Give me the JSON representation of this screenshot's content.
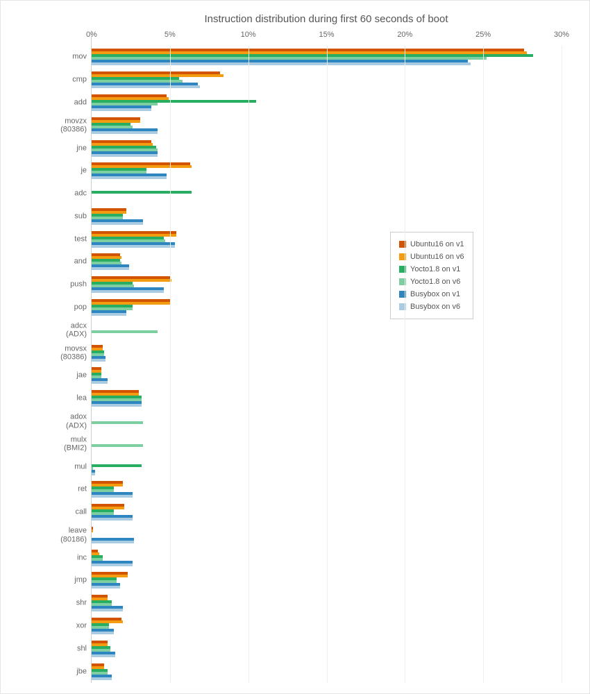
{
  "chart_data": {
    "type": "bar",
    "orientation": "horizontal",
    "title": "Instruction distribution during first 60 seconds of boot",
    "xlabel": "",
    "ylabel": "",
    "xlim": [
      0,
      30
    ],
    "xticks": [
      0,
      5,
      10,
      15,
      20,
      25,
      30
    ],
    "xtick_labels": [
      "0%",
      "5%",
      "10%",
      "15%",
      "20%",
      "25%",
      "30%"
    ],
    "categories": [
      "mov",
      "cmp",
      "add",
      "movzx (80386)",
      "jne",
      "je",
      "adc",
      "sub",
      "test",
      "and",
      "push",
      "pop",
      "adcx (ADX)",
      "movsx (80386)",
      "jae",
      "lea",
      "adox (ADX)",
      "mulx (BMI2)",
      "mul",
      "ret",
      "call",
      "leave (80186)",
      "inc",
      "jmp",
      "shr",
      "xor",
      "shl",
      "jbe"
    ],
    "series": [
      {
        "name": "Ubuntu16 on v1",
        "color": "#d35400",
        "values": [
          27.6,
          8.2,
          4.8,
          3.1,
          3.8,
          6.3,
          0,
          2.2,
          5.4,
          1.8,
          5.0,
          5.0,
          0,
          0.7,
          0.6,
          3.0,
          0,
          0,
          0,
          2.0,
          2.1,
          0.1,
          0.4,
          2.3,
          1.0,
          1.9,
          1.0,
          0.8
        ]
      },
      {
        "name": "Ubuntu16 on v6",
        "color": "#f39c12",
        "values": [
          27.8,
          8.4,
          4.9,
          3.1,
          3.9,
          6.4,
          0,
          2.2,
          5.4,
          1.9,
          5.1,
          5.0,
          0,
          0.7,
          0.6,
          3.0,
          0,
          0,
          0,
          2.0,
          2.1,
          0.1,
          0.5,
          2.3,
          1.0,
          2.0,
          1.0,
          0.8
        ]
      },
      {
        "name": "Yocto1.8 on v1",
        "color": "#27ae60",
        "values": [
          28.2,
          5.6,
          10.5,
          2.5,
          4.1,
          3.5,
          6.4,
          2.0,
          4.6,
          1.8,
          2.6,
          2.6,
          0,
          0.8,
          0.6,
          3.2,
          0,
          0,
          3.2,
          1.4,
          1.4,
          0,
          0.7,
          1.6,
          1.3,
          1.1,
          1.2,
          1.0
        ]
      },
      {
        "name": "Yocto1.8 on v6",
        "color": "#7dcea0",
        "values": [
          25.2,
          5.8,
          4.2,
          2.6,
          4.2,
          3.5,
          0,
          2.0,
          4.7,
          1.9,
          2.7,
          2.6,
          4.2,
          0.8,
          0.6,
          3.2,
          3.3,
          3.3,
          0.1,
          1.4,
          1.4,
          0,
          0.7,
          1.6,
          1.3,
          1.1,
          1.2,
          1.0
        ]
      },
      {
        "name": "Busybox on v1",
        "color": "#2e86c1",
        "values": [
          24,
          6.8,
          3.8,
          4.2,
          4.2,
          4.8,
          0,
          3.3,
          5.3,
          2.4,
          4.6,
          2.2,
          0,
          0.9,
          1.0,
          3.2,
          0,
          0,
          0.2,
          2.6,
          2.6,
          2.7,
          2.6,
          1.8,
          2.0,
          1.4,
          1.5,
          1.3
        ]
      },
      {
        "name": "Busybox on v6",
        "color": "#a9cce3",
        "values": [
          24.2,
          6.9,
          3.8,
          4.2,
          4.2,
          4.8,
          0,
          3.3,
          5.3,
          2.4,
          4.6,
          2.2,
          0,
          0.9,
          1.0,
          3.2,
          0,
          0,
          0.2,
          2.6,
          2.6,
          2.7,
          2.6,
          1.8,
          2.0,
          1.4,
          1.5,
          1.3
        ]
      }
    ],
    "legend_position": "right"
  }
}
